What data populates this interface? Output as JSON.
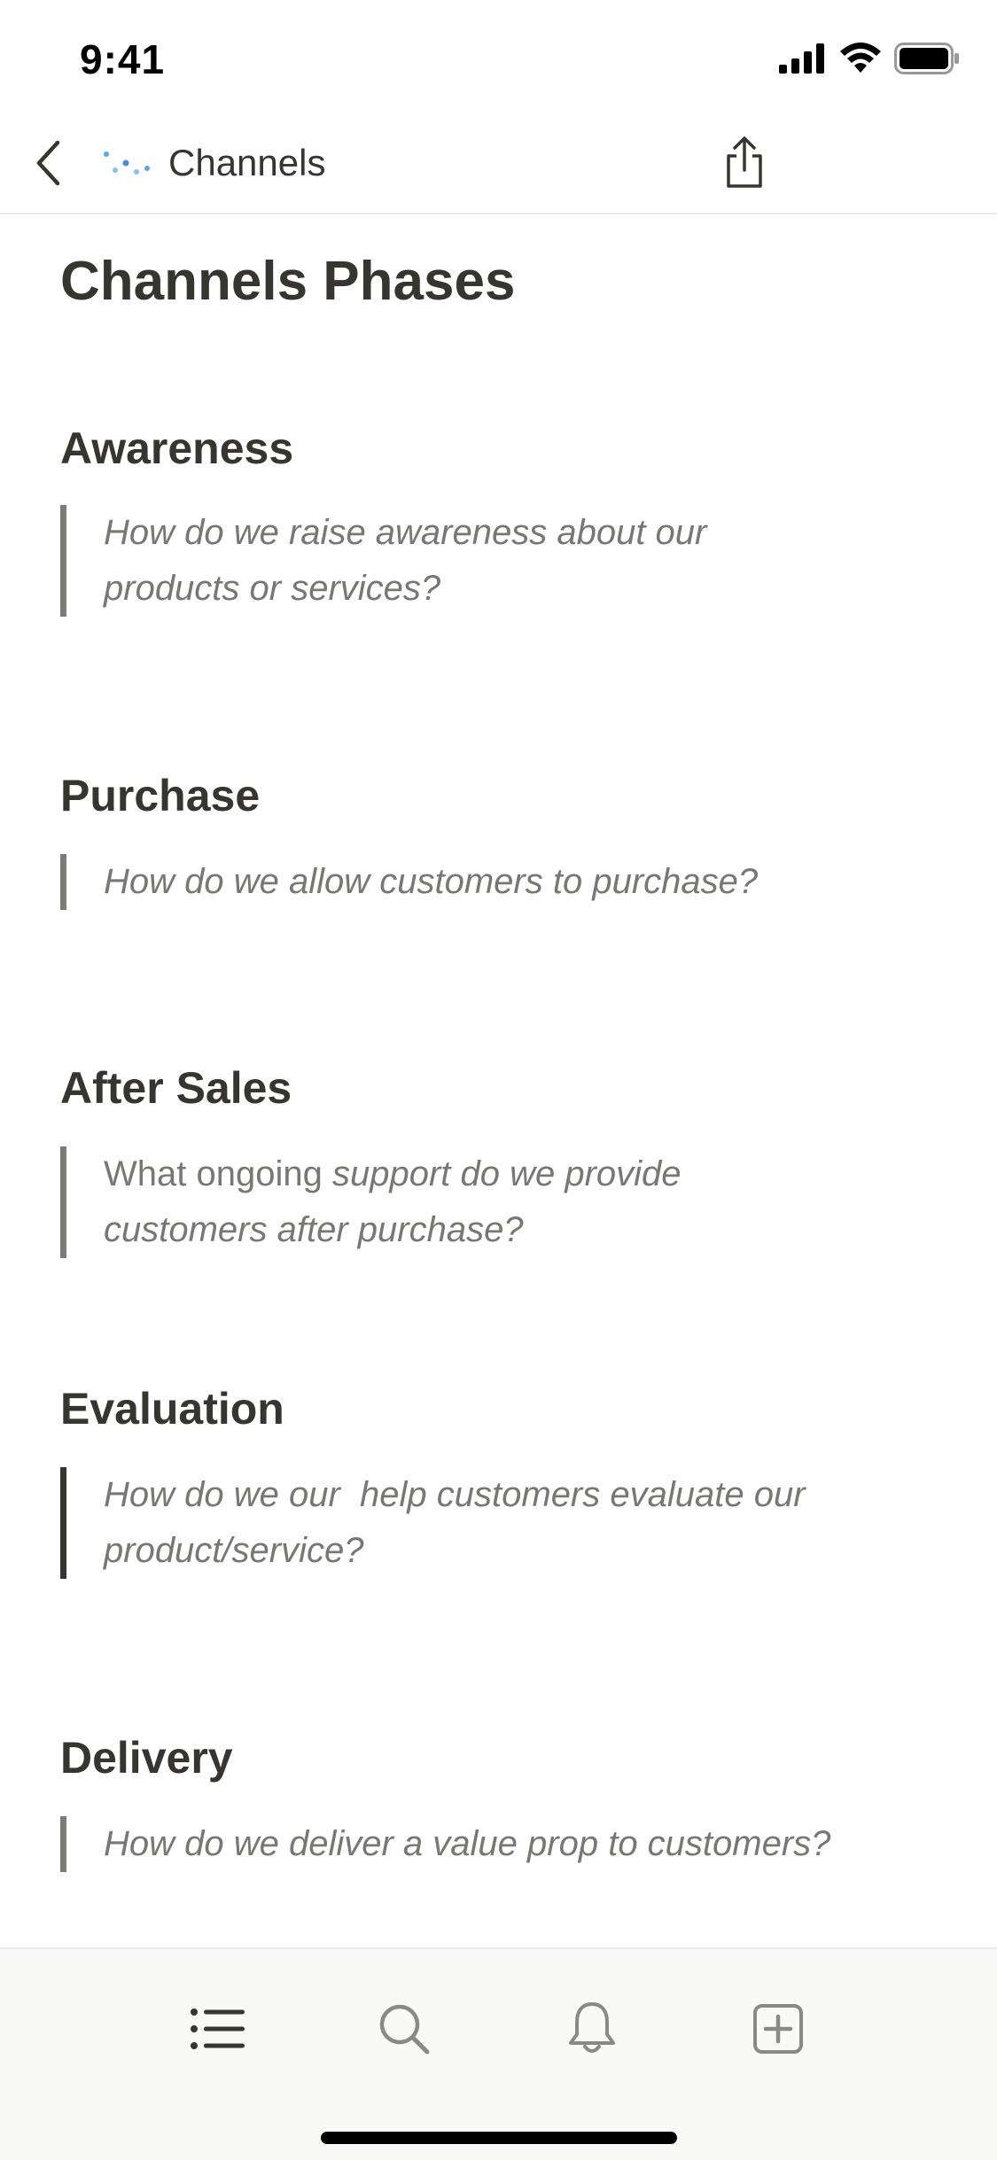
{
  "status_bar": {
    "time": "9:41"
  },
  "nav": {
    "title": "Channels",
    "icons": {
      "back": "chevron-left-icon",
      "page": "sparkle-dots-icon",
      "share": "share-icon"
    }
  },
  "page": {
    "title": "Channels Phases",
    "sections": [
      {
        "heading": "Awareness",
        "quote_lines": [
          "How do we raise awareness about our",
          "products or services?"
        ]
      },
      {
        "heading": "Purchase",
        "quote_lines": [
          "How do we allow customers to purchase?"
        ]
      },
      {
        "heading": "After Sales",
        "quote_prefix": "What ongoing ",
        "quote_line1_rest": "support do we provide",
        "quote_line2": "customers after purchase?"
      },
      {
        "heading": "Evaluation",
        "quote_lines": [
          "How do we our  help customers evaluate our",
          "product/service?"
        ]
      },
      {
        "heading": "Delivery",
        "quote_lines": [
          "How do we deliver a value prop to customers?"
        ]
      }
    ]
  },
  "tab_bar": {
    "tabs": [
      {
        "icon": "list-icon"
      },
      {
        "icon": "search-icon"
      },
      {
        "icon": "bell-icon"
      },
      {
        "icon": "new-page-icon"
      }
    ]
  },
  "colors": {
    "text": "#37352f",
    "quote_text": "#787774",
    "quote_border": "#7c7b77",
    "tab_bar_bg": "#f9f9f8"
  }
}
